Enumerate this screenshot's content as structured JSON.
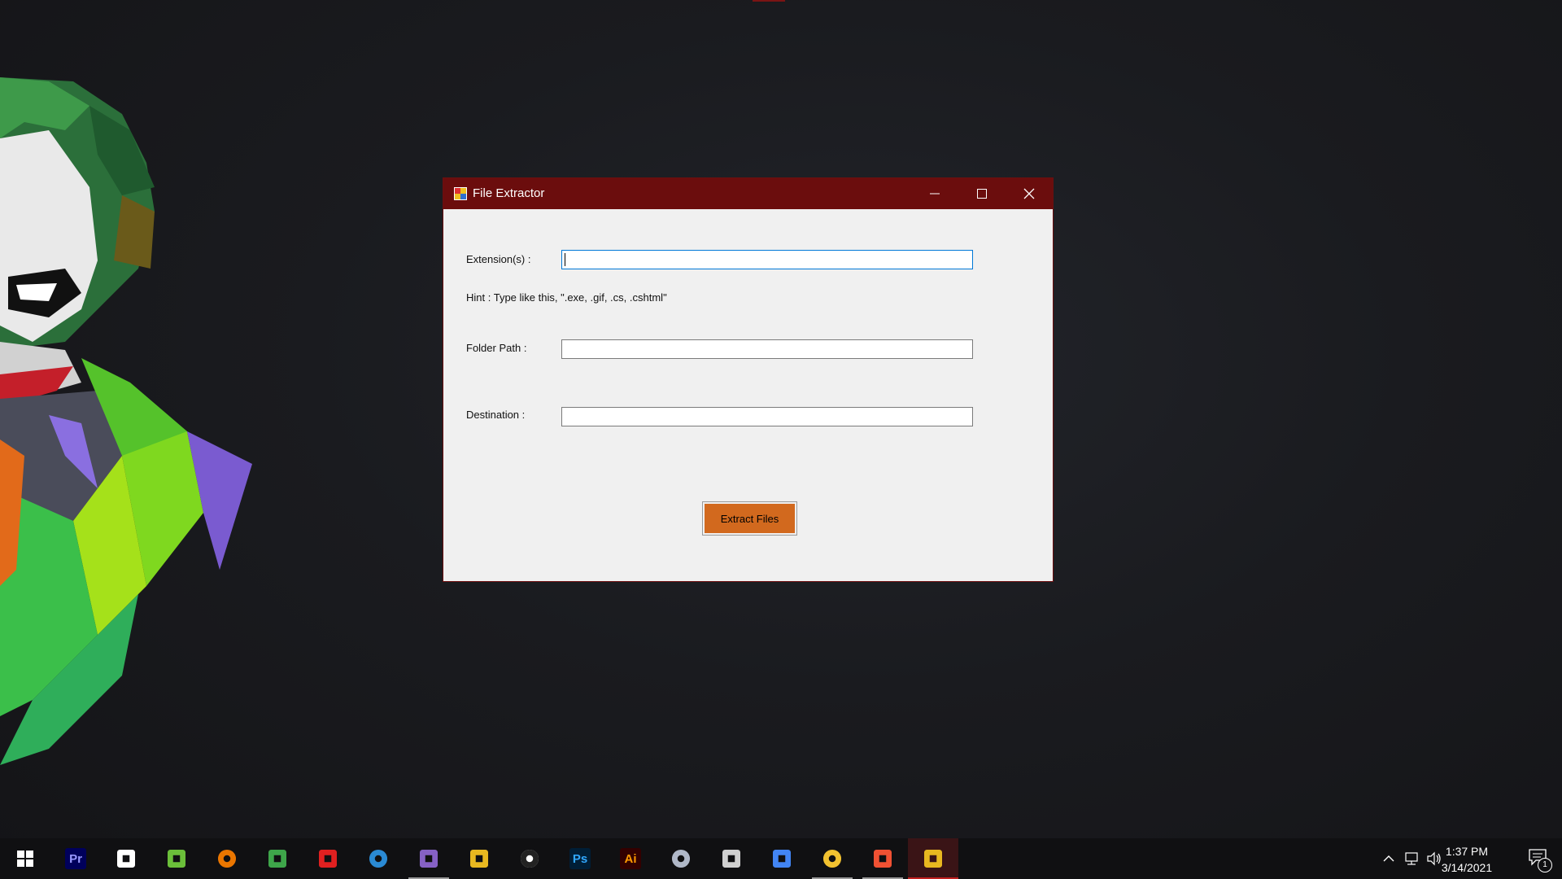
{
  "window": {
    "title": "File Extractor",
    "icon": "file-extractor-app-icon",
    "controls": {
      "minimize": "minimize-icon",
      "maximize": "maximize-icon",
      "close": "close-icon"
    }
  },
  "form": {
    "extensions_label": "Extension(s) :",
    "extensions_value": "",
    "hint": "Hint : Type like this, \".exe, .gif, .cs, .cshtml\"",
    "folder_label": "Folder Path :",
    "folder_value": "",
    "destination_label": "Destination :",
    "destination_value": "",
    "extract_button": "Extract Files",
    "button_color": "#d2691e"
  },
  "taskbar": {
    "start_icon": "windows-start-icon",
    "apps": [
      {
        "name": "premiere-pro-icon",
        "label": "Pr",
        "color": "#9999ff",
        "bg": "#00005b",
        "active": false
      },
      {
        "name": "obs-icon",
        "label": "",
        "color": "#ffffff",
        "bg": "",
        "active": false
      },
      {
        "name": "notepad-icon",
        "label": "",
        "color": "#6bbf3a",
        "bg": "",
        "active": false
      },
      {
        "name": "blender-icon",
        "label": "",
        "color": "#ea7600",
        "bg": "",
        "active": false
      },
      {
        "name": "atlas-icon",
        "label": "",
        "color": "#3ea64a",
        "bg": "",
        "active": false
      },
      {
        "name": "heart-app-icon",
        "label": "",
        "color": "#e02020",
        "bg": "",
        "active": false
      },
      {
        "name": "vscode-icon",
        "label": "",
        "color": "#2a8ad4",
        "bg": "",
        "active": false
      },
      {
        "name": "visual-studio-icon",
        "label": "",
        "color": "#8661c5",
        "bg": "",
        "active": true
      },
      {
        "name": "device-manager-icon",
        "label": "",
        "color": "#e8b820",
        "bg": "",
        "active": false
      },
      {
        "name": "unity-icon",
        "label": "",
        "color": "#222222",
        "bg": "#ffffff",
        "active": false
      },
      {
        "name": "photoshop-icon",
        "label": "Ps",
        "color": "#31a8ff",
        "bg": "#001e36",
        "active": false
      },
      {
        "name": "illustrator-icon",
        "label": "Ai",
        "color": "#ff9a00",
        "bg": "#330000",
        "active": false
      },
      {
        "name": "settings-tool-icon",
        "label": "",
        "color": "#b0b8c8",
        "bg": "",
        "active": false
      },
      {
        "name": "window-capture-icon",
        "label": "",
        "color": "#d0d0d0",
        "bg": "",
        "active": false
      },
      {
        "name": "chrome-icon",
        "label": "",
        "color": "#4285f4",
        "bg": "",
        "active": false
      },
      {
        "name": "file-explorer-icon",
        "label": "",
        "color": "#f2c230",
        "bg": "",
        "active": true
      },
      {
        "name": "git-icon",
        "label": "",
        "color": "#f05133",
        "bg": "",
        "active": true
      },
      {
        "name": "file-extractor-taskbar-icon",
        "label": "",
        "color": "#e8b820",
        "bg": "",
        "active": true,
        "focused": true
      }
    ],
    "tray": {
      "chevron_icon": "chevron-up-icon",
      "network_icon": "network-icon",
      "volume_icon": "volume-icon",
      "time": "1:37 PM",
      "date": "3/14/2021",
      "notification_icon": "notification-icon",
      "notification_count": "1"
    }
  }
}
